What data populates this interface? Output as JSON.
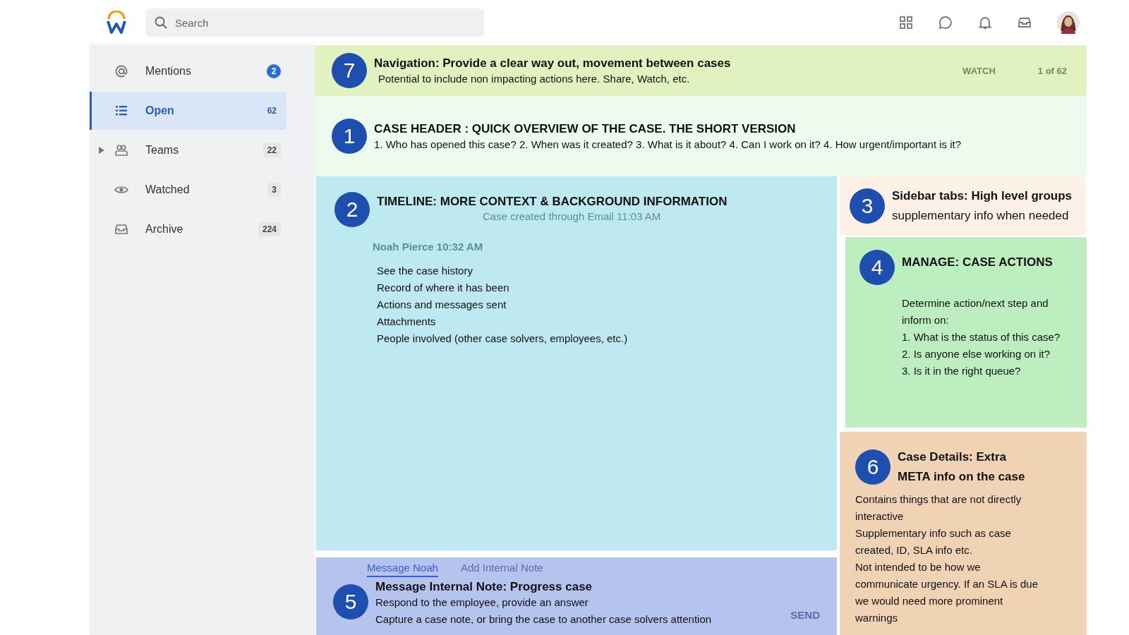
{
  "header": {
    "search": {
      "placeholder": "Search"
    }
  },
  "sidebar": {
    "items": [
      {
        "label": "Mentions",
        "count": "2",
        "selected": false,
        "expandable": false,
        "highlight": true
      },
      {
        "label": "Open",
        "count": "62",
        "selected": true,
        "expandable": false,
        "highlight": false
      },
      {
        "label": "Teams",
        "count": "22",
        "selected": false,
        "expandable": true,
        "highlight": false
      },
      {
        "label": "Watched",
        "count": "3",
        "selected": false,
        "expandable": false,
        "highlight": false
      },
      {
        "label": "Archive",
        "count": "224",
        "selected": false,
        "expandable": false,
        "highlight": false
      }
    ]
  },
  "navigation": {
    "watch": "WATCH",
    "pager": "1 of 62",
    "note": {
      "number": "7",
      "title": "Navigation: Provide a clear way out, movement between cases",
      "lines": [
        "Potential to include non impacting actions here. Share, Watch, etc."
      ]
    }
  },
  "case_header": {
    "note": {
      "number": "1",
      "title": "CASE HEADER : QUICK OVERVIEW OF THE CASE. THE SHORT VERSION",
      "lines": [
        "1. Who has opened this case? 2. When was it created? 3. What is it about? 4. Can I work on it? 4. How urgent/important is it?"
      ]
    }
  },
  "timeline": {
    "event": "Case created through Email",
    "event_time": "11:03 AM",
    "message": {
      "author": "Noah Pierce",
      "time": "10:32 AM"
    },
    "note": {
      "number": "2",
      "title": "TIMELINE: MORE CONTEXT & BACKGROUND INFORMATION",
      "lines": [
        "See the case history",
        "Record of where it has been",
        "Actions and messages sent",
        "Attachments",
        "People involved (other case solvers, employees, etc.)"
      ]
    }
  },
  "sidebar_tabs": {
    "note": {
      "number": "3",
      "title": "Sidebar tabs: High level groups",
      "lines": [
        "supplementary info when needed"
      ]
    }
  },
  "case_actions": {
    "note": {
      "number": "4",
      "title": "MANAGE: CASE ACTIONS",
      "lines": [
        "Determine action/next step and inform on:",
        "1. What is the status of this case?",
        "2. Is anyone else working on it?",
        "3. Is it in the right queue?"
      ]
    }
  },
  "case_details": {
    "note": {
      "number": "6",
      "title": "Case Details: Extra META info on the case",
      "lines": [
        "Contains things that are not directly interactive",
        "Supplementary info such as case created, ID, SLA info etc.",
        "Not intended to be how we communicate urgency. If an SLA is due we would need more prominent warnings"
      ]
    }
  },
  "composer": {
    "tabs": [
      {
        "label": "Message Noah",
        "selected": true
      },
      {
        "label": "Add Internal Note",
        "selected": false
      }
    ],
    "send": "SEND",
    "note": {
      "number": "5",
      "title": "Message Internal Note: Progress case",
      "lines": [
        "Respond to the employee, provide an answer",
        "Capture a case note, or bring the case to another case solvers attention"
      ]
    }
  }
}
